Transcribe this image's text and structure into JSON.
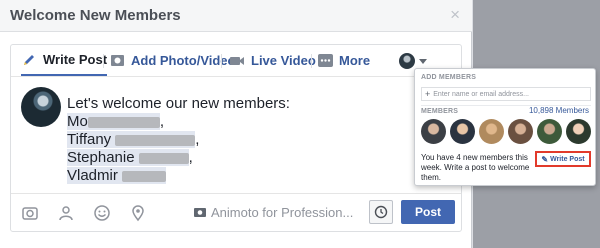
{
  "dialog": {
    "title": "Welcome New Members",
    "close_glyph": "×"
  },
  "tabs": [
    {
      "label": "Write Post",
      "icon": "pencil-icon",
      "active": true
    },
    {
      "label": "Add Photo/Video",
      "icon": "photo-icon",
      "active": false
    },
    {
      "label": "Live Video",
      "icon": "video-camera-icon",
      "active": false
    },
    {
      "label": "More",
      "icon": "more-icon",
      "active": false
    }
  ],
  "post": {
    "intro": "Let's welcome our new members:",
    "mentions": [
      {
        "name": "Mo",
        "suffix": ","
      },
      {
        "name": "Tiffany",
        "suffix": ","
      },
      {
        "name": "Stephanie",
        "suffix": ","
      },
      {
        "name": "Vladmir",
        "suffix": ""
      }
    ]
  },
  "bottom_bar": {
    "tools": [
      "camera-icon",
      "tag-people-icon",
      "feeling-icon",
      "location-icon"
    ],
    "animoto_label": "Animoto for Profession...",
    "post_label": "Post"
  },
  "popover": {
    "add_members_label": "ADD MEMBERS",
    "input_placeholder": "Enter name or email address...",
    "members_label": "MEMBERS",
    "members_count": "10,898 Members",
    "text": "You have 4 new members this week. Write a post to welcome them.",
    "write_post_label": "Write Post"
  },
  "colors": {
    "accent": "#4267b2",
    "link": "#365899",
    "highlight": "#e23a2b"
  }
}
